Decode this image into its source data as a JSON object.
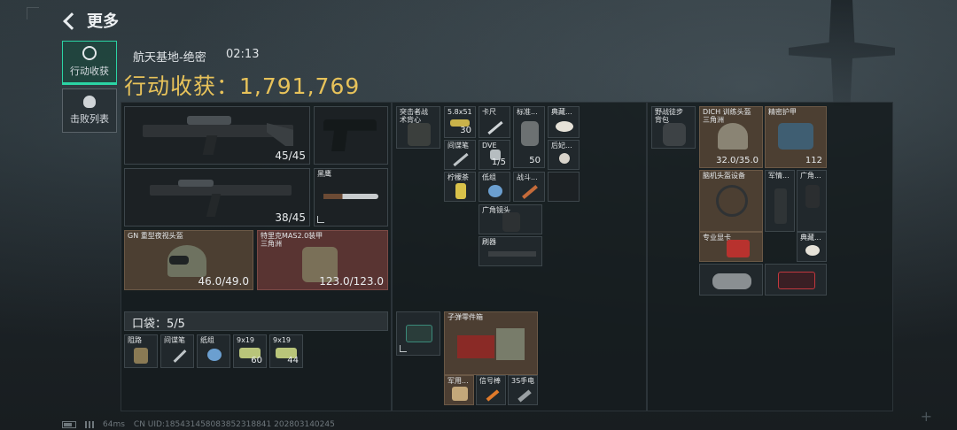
{
  "header": {
    "title": "更多"
  },
  "side_tabs": [
    {
      "label": "行动收获",
      "active": true
    },
    {
      "label": "击败列表",
      "active": false
    }
  ],
  "raid": {
    "map": "航天基地-绝密",
    "time": "02:13",
    "harvest_label": "行动收获：",
    "harvest_value": "1,791,769"
  },
  "weapons": [
    {
      "ammo": "45/45"
    },
    {
      "ammo": "38/45"
    }
  ],
  "melee": {
    "label": "黑鹰"
  },
  "gear": [
    {
      "label": "GN 重型夜视头盔",
      "durability": "46.0/49.0"
    },
    {
      "label": "特里克MAS2.0装甲\n三角洲",
      "durability": "123.0/123.0"
    }
  ],
  "pocket": {
    "label": "口袋：5/5",
    "items": [
      {
        "label": "阻路",
        "count": ""
      },
      {
        "label": "间谍笔",
        "count": ""
      },
      {
        "label": "纸组",
        "count": ""
      },
      {
        "label": "9x19",
        "count": "60"
      },
      {
        "label": "9x19",
        "count": "44"
      }
    ]
  },
  "chest_rig": {
    "label": "突击者战\n术背心"
  },
  "rig_items": [
    {
      "label": "5.8x51",
      "count": "30"
    },
    {
      "label": "卡尺",
      "count": ""
    },
    {
      "label": "标准...",
      "count": ""
    },
    {
      "label": "典藏...",
      "count": ""
    },
    {
      "label": "间谍笔",
      "count": ""
    },
    {
      "label": "DVE",
      "count": "1/5"
    },
    {
      "label": "",
      "count": "50"
    },
    {
      "label": "后妃...",
      "count": ""
    },
    {
      "label": "柠檬茶",
      "count": ""
    },
    {
      "label": "低组",
      "count": ""
    },
    {
      "label": "战斗...",
      "count": ""
    },
    {
      "label": "广角镜头",
      "count": ""
    },
    {
      "label": "刷器",
      "count": ""
    }
  ],
  "backpack_box": {
    "label": ""
  },
  "backpack": {
    "label": "子弹零件箱",
    "items": [
      {
        "label": "军用..."
      },
      {
        "label": "信号棒"
      },
      {
        "label": "3S手电"
      }
    ]
  },
  "bag": {
    "label": "野战徒步\n背包"
  },
  "stash": [
    {
      "label": "DICH 训练头盔\n三角洲",
      "count": "32.0/35.0"
    },
    {
      "label": "精密护甲",
      "count": "112"
    },
    {
      "label": "脑机头盔设备",
      "count": ""
    },
    {
      "label": "军情...",
      "count": ""
    },
    {
      "label": "广角...",
      "count": ""
    },
    {
      "label": "专业显卡",
      "count": ""
    },
    {
      "label": "典藏...",
      "count": ""
    },
    {
      "label": "",
      "count": ""
    },
    {
      "label": "",
      "count": ""
    }
  ],
  "footer": {
    "ping": "64ms",
    "uid": "CN UID:1854314580838523188​41 20280314​0245"
  }
}
